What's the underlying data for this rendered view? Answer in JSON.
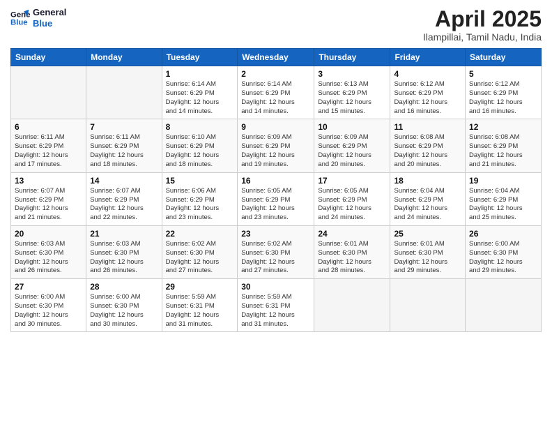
{
  "header": {
    "logo_line1": "General",
    "logo_line2": "Blue",
    "title": "April 2025",
    "subtitle": "Ilampillai, Tamil Nadu, India"
  },
  "calendar": {
    "days_of_week": [
      "Sunday",
      "Monday",
      "Tuesday",
      "Wednesday",
      "Thursday",
      "Friday",
      "Saturday"
    ],
    "weeks": [
      [
        {
          "day": "",
          "info": ""
        },
        {
          "day": "",
          "info": ""
        },
        {
          "day": "1",
          "info": "Sunrise: 6:14 AM\nSunset: 6:29 PM\nDaylight: 12 hours\nand 14 minutes."
        },
        {
          "day": "2",
          "info": "Sunrise: 6:14 AM\nSunset: 6:29 PM\nDaylight: 12 hours\nand 14 minutes."
        },
        {
          "day": "3",
          "info": "Sunrise: 6:13 AM\nSunset: 6:29 PM\nDaylight: 12 hours\nand 15 minutes."
        },
        {
          "day": "4",
          "info": "Sunrise: 6:12 AM\nSunset: 6:29 PM\nDaylight: 12 hours\nand 16 minutes."
        },
        {
          "day": "5",
          "info": "Sunrise: 6:12 AM\nSunset: 6:29 PM\nDaylight: 12 hours\nand 16 minutes."
        }
      ],
      [
        {
          "day": "6",
          "info": "Sunrise: 6:11 AM\nSunset: 6:29 PM\nDaylight: 12 hours\nand 17 minutes."
        },
        {
          "day": "7",
          "info": "Sunrise: 6:11 AM\nSunset: 6:29 PM\nDaylight: 12 hours\nand 18 minutes."
        },
        {
          "day": "8",
          "info": "Sunrise: 6:10 AM\nSunset: 6:29 PM\nDaylight: 12 hours\nand 18 minutes."
        },
        {
          "day": "9",
          "info": "Sunrise: 6:09 AM\nSunset: 6:29 PM\nDaylight: 12 hours\nand 19 minutes."
        },
        {
          "day": "10",
          "info": "Sunrise: 6:09 AM\nSunset: 6:29 PM\nDaylight: 12 hours\nand 20 minutes."
        },
        {
          "day": "11",
          "info": "Sunrise: 6:08 AM\nSunset: 6:29 PM\nDaylight: 12 hours\nand 20 minutes."
        },
        {
          "day": "12",
          "info": "Sunrise: 6:08 AM\nSunset: 6:29 PM\nDaylight: 12 hours\nand 21 minutes."
        }
      ],
      [
        {
          "day": "13",
          "info": "Sunrise: 6:07 AM\nSunset: 6:29 PM\nDaylight: 12 hours\nand 21 minutes."
        },
        {
          "day": "14",
          "info": "Sunrise: 6:07 AM\nSunset: 6:29 PM\nDaylight: 12 hours\nand 22 minutes."
        },
        {
          "day": "15",
          "info": "Sunrise: 6:06 AM\nSunset: 6:29 PM\nDaylight: 12 hours\nand 23 minutes."
        },
        {
          "day": "16",
          "info": "Sunrise: 6:05 AM\nSunset: 6:29 PM\nDaylight: 12 hours\nand 23 minutes."
        },
        {
          "day": "17",
          "info": "Sunrise: 6:05 AM\nSunset: 6:29 PM\nDaylight: 12 hours\nand 24 minutes."
        },
        {
          "day": "18",
          "info": "Sunrise: 6:04 AM\nSunset: 6:29 PM\nDaylight: 12 hours\nand 24 minutes."
        },
        {
          "day": "19",
          "info": "Sunrise: 6:04 AM\nSunset: 6:29 PM\nDaylight: 12 hours\nand 25 minutes."
        }
      ],
      [
        {
          "day": "20",
          "info": "Sunrise: 6:03 AM\nSunset: 6:30 PM\nDaylight: 12 hours\nand 26 minutes."
        },
        {
          "day": "21",
          "info": "Sunrise: 6:03 AM\nSunset: 6:30 PM\nDaylight: 12 hours\nand 26 minutes."
        },
        {
          "day": "22",
          "info": "Sunrise: 6:02 AM\nSunset: 6:30 PM\nDaylight: 12 hours\nand 27 minutes."
        },
        {
          "day": "23",
          "info": "Sunrise: 6:02 AM\nSunset: 6:30 PM\nDaylight: 12 hours\nand 27 minutes."
        },
        {
          "day": "24",
          "info": "Sunrise: 6:01 AM\nSunset: 6:30 PM\nDaylight: 12 hours\nand 28 minutes."
        },
        {
          "day": "25",
          "info": "Sunrise: 6:01 AM\nSunset: 6:30 PM\nDaylight: 12 hours\nand 29 minutes."
        },
        {
          "day": "26",
          "info": "Sunrise: 6:00 AM\nSunset: 6:30 PM\nDaylight: 12 hours\nand 29 minutes."
        }
      ],
      [
        {
          "day": "27",
          "info": "Sunrise: 6:00 AM\nSunset: 6:30 PM\nDaylight: 12 hours\nand 30 minutes."
        },
        {
          "day": "28",
          "info": "Sunrise: 6:00 AM\nSunset: 6:30 PM\nDaylight: 12 hours\nand 30 minutes."
        },
        {
          "day": "29",
          "info": "Sunrise: 5:59 AM\nSunset: 6:31 PM\nDaylight: 12 hours\nand 31 minutes."
        },
        {
          "day": "30",
          "info": "Sunrise: 5:59 AM\nSunset: 6:31 PM\nDaylight: 12 hours\nand 31 minutes."
        },
        {
          "day": "",
          "info": ""
        },
        {
          "day": "",
          "info": ""
        },
        {
          "day": "",
          "info": ""
        }
      ]
    ]
  }
}
